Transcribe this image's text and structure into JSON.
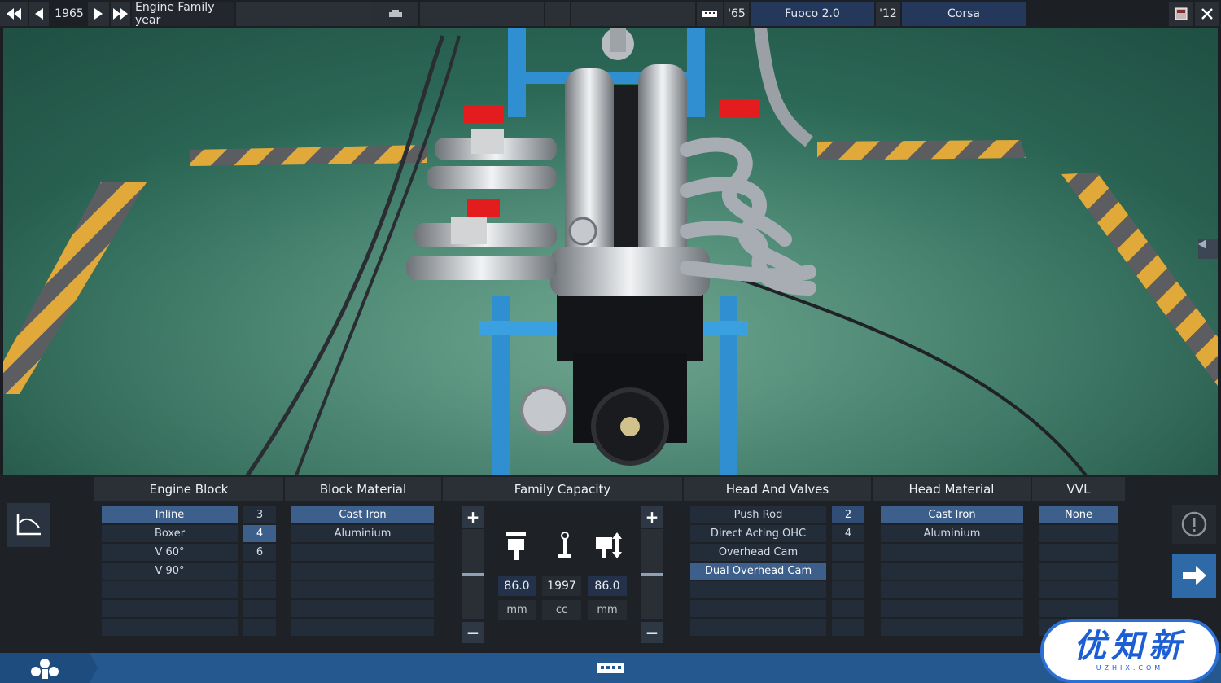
{
  "topbar": {
    "year": "1965",
    "family_year_label": "Engine Family year",
    "model_year": "'65",
    "family_name": "Fuoco 2.0",
    "variant_year": "'12",
    "variant_name": "Corsa"
  },
  "columns": {
    "engine_block": "Engine Block",
    "block_material": "Block Material",
    "family_capacity": "Family Capacity",
    "head_and_valves": "Head And Valves",
    "head_material": "Head Material",
    "vvl": "VVL"
  },
  "engine_block": {
    "layouts": [
      "Inline",
      "Boxer",
      "V 60°",
      "V 90°"
    ],
    "cylinders": [
      "3",
      "4",
      "6"
    ]
  },
  "block_material": {
    "options": [
      "Cast Iron",
      "Aluminium"
    ]
  },
  "capacity": {
    "bore": "86.0",
    "displacement": "1997",
    "stroke": "86.0",
    "bore_unit": "mm",
    "displacement_unit": "cc",
    "stroke_unit": "mm"
  },
  "head_and_valves": {
    "types": [
      "Push Rod",
      "Direct Acting OHC",
      "Overhead Cam",
      "Dual Overhead Cam"
    ],
    "valves": [
      "2",
      "4"
    ]
  },
  "head_material": {
    "options": [
      "Cast Iron",
      "Aluminium"
    ]
  },
  "vvl": {
    "options": [
      "None"
    ]
  },
  "watermark": {
    "main": "优知新",
    "sub": "UZHIX.COM"
  },
  "colors": {
    "accent": "#3c5f8c",
    "bottombar": "#25588e",
    "floor": "#2f6e5b",
    "frame": "#2f8fd0"
  }
}
